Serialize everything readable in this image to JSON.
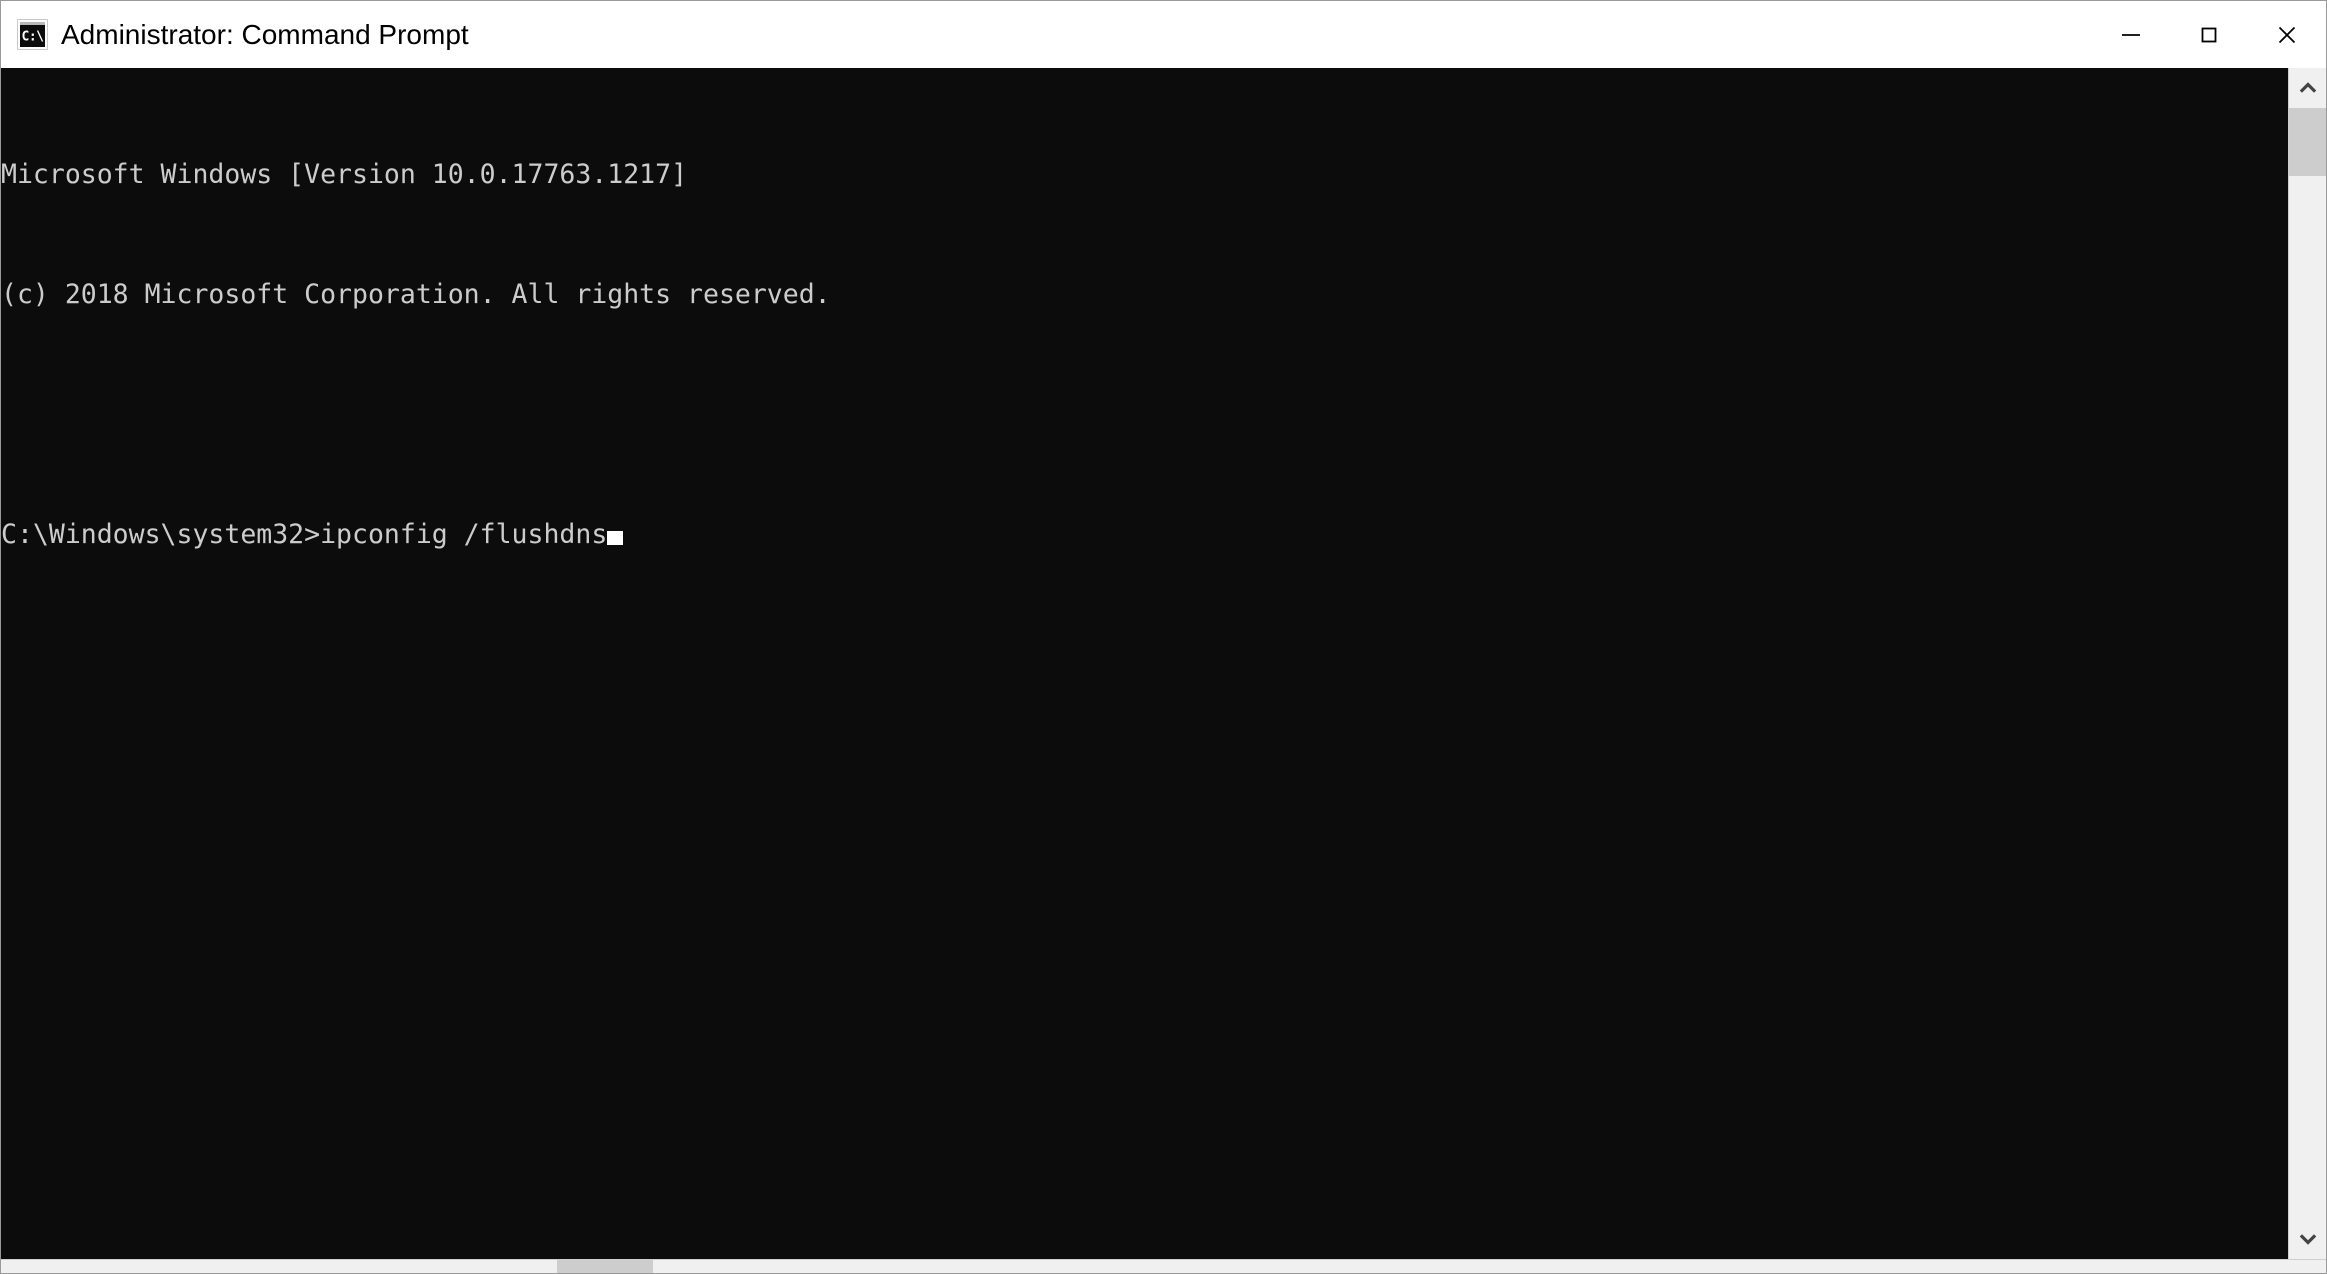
{
  "window": {
    "title": "Administrator: Command Prompt",
    "icon_name": "cmd-console-icon",
    "icon_glyph": "C:\\",
    "controls": {
      "minimize_label": "Minimize",
      "maximize_label": "Maximize",
      "close_label": "Close"
    },
    "colors": {
      "titlebar_background": "#ffffff",
      "titlebar_text": "#000000",
      "console_background": "#0c0c0c",
      "console_text": "#cccccc",
      "cursor": "#ffffff",
      "scrollbar_track": "#f0f0f0",
      "scrollbar_thumb": "#cdcdcd",
      "window_border": "#9a9a9a"
    }
  },
  "console": {
    "lines": [
      "Microsoft Windows [Version 10.0.17763.1217]",
      "(c) 2018 Microsoft Corporation. All rights reserved.",
      "",
      ""
    ],
    "prompt": "C:\\Windows\\system32>",
    "command": "ipconfig /flushdns",
    "cursor_visible": true
  },
  "scrollbar": {
    "up_arrow_label": "Scroll up",
    "down_arrow_label": "Scroll down",
    "thumb_label": "Vertical scroll thumb",
    "h_thumb_label": "Horizontal scroll thumb"
  }
}
